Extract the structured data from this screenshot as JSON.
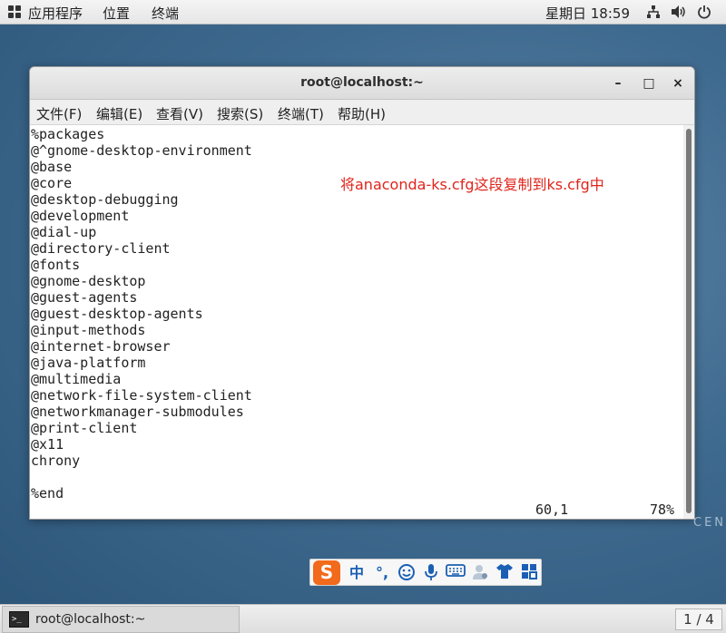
{
  "topbar": {
    "applications": "应用程序",
    "places": "位置",
    "terminal": "终端",
    "clock": "星期日 18:59"
  },
  "window": {
    "title": "root@localhost:~",
    "controls": {
      "minimize": "–",
      "maximize": "□",
      "close": "×"
    },
    "menu": [
      "文件(F)",
      "编辑(E)",
      "查看(V)",
      "搜索(S)",
      "终端(T)",
      "帮助(H)"
    ]
  },
  "terminal": {
    "lines": [
      "%packages",
      "@^gnome-desktop-environment",
      "@base",
      "@core",
      "@desktop-debugging",
      "@development",
      "@dial-up",
      "@directory-client",
      "@fonts",
      "@gnome-desktop",
      "@guest-agents",
      "@guest-desktop-agents",
      "@input-methods",
      "@internet-browser",
      "@java-platform",
      "@multimedia",
      "@network-file-system-client",
      "@networkmanager-submodules",
      "@print-client",
      "@x11",
      "chrony",
      "",
      "%end"
    ],
    "annotation": "将anaconda-ks.cfg这段复制到ks.cfg中",
    "cursor_position": "60,1",
    "scroll_percent": "78%"
  },
  "ime": {
    "logo": "S",
    "mode": "中",
    "punct": "°,",
    "items": [
      "emoji-icon",
      "mic-icon",
      "keyboard-icon",
      "user-icon",
      "skin-icon",
      "toolbox-icon"
    ]
  },
  "taskbar": {
    "task_label": "root@localhost:~",
    "workspace": "1 / 4"
  },
  "desktop": {
    "watermark": "CEN"
  },
  "colors": {
    "annotation": "#e0241b",
    "ime_logo": "#f26a1b",
    "ime_icons": "#1a5fb4"
  }
}
